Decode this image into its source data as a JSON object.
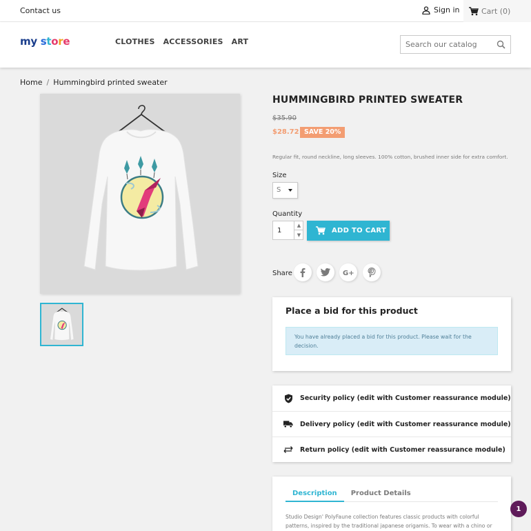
{
  "topbar": {
    "contact": "Contact us",
    "sign_in": "Sign in",
    "cart": "Cart (0)"
  },
  "header": {
    "logo_text": "my store",
    "nav": [
      "CLOTHES",
      "ACCESSORIES",
      "ART"
    ],
    "search_placeholder": "Search our catalog"
  },
  "breadcrumb": {
    "home": "Home",
    "separator": "/",
    "current": "Hummingbird printed sweater"
  },
  "product": {
    "title": "HUMMINGBIRD PRINTED SWEATER",
    "old_price": "$35.90",
    "price": "$28.72",
    "discount": "SAVE 20%",
    "short_description": "Regular fit, round neckline, long sleeves. 100% cotton, brushed inner side for extra comfort.",
    "size_label": "Size",
    "size_value": "S",
    "quantity_label": "Quantity",
    "quantity_value": "1",
    "add_to_cart": "ADD TO CART",
    "share_label": "Share",
    "share_icons": [
      "facebook-icon",
      "twitter-icon",
      "google-plus-icon",
      "pinterest-icon"
    ]
  },
  "bid": {
    "title": "Place a bid for this product",
    "message": "You have already placed a bid for this product. Please wait for the decision."
  },
  "reassurance": [
    {
      "icon": "shield-check-icon",
      "label": "Security policy (edit with Customer reassurance module)"
    },
    {
      "icon": "truck-icon",
      "label": "Delivery policy (edit with Customer reassurance module)"
    },
    {
      "icon": "swap-arrows-icon",
      "label": "Return policy (edit with Customer reassurance module)"
    }
  ],
  "tabs": {
    "items": [
      "Description",
      "Product Details"
    ],
    "active": "Description",
    "description": "Studio Design' PolyFaune collection features classic products with colorful patterns, inspired by the traditional japanese origamis. To wear with a chino or"
  },
  "notification_badge": "1",
  "colors": {
    "accent": "#2fb5d2",
    "discount": "#f39d72",
    "badge": "#5f1b5a"
  }
}
